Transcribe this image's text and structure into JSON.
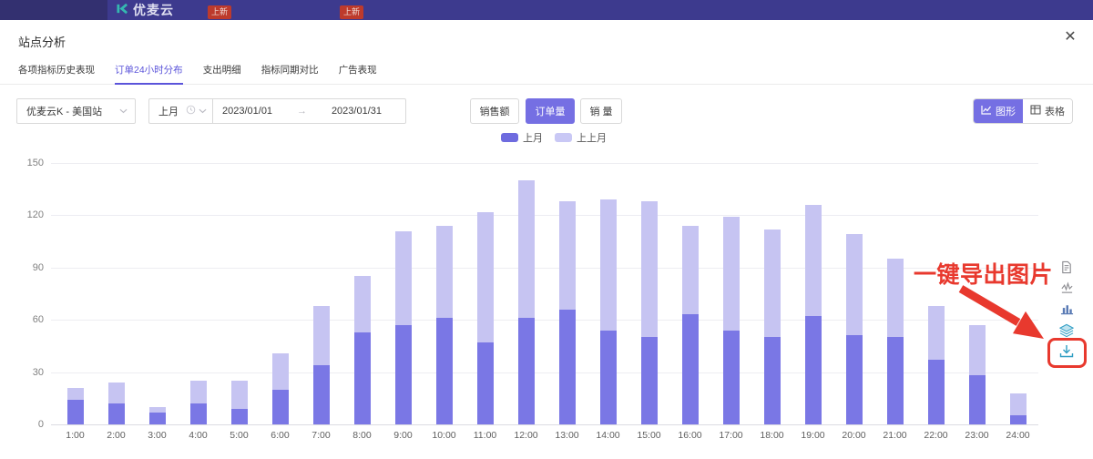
{
  "navbar": {
    "logo_text": "优麦云",
    "badges": [
      "上新",
      "上新"
    ],
    "bg_color": "#3d3a8e"
  },
  "panel": {
    "title": "站点分析",
    "close_label": "✕"
  },
  "tabs": [
    {
      "label": "各项指标历史表现",
      "active": false
    },
    {
      "label": "订单24小时分布",
      "active": true
    },
    {
      "label": "支出明细",
      "active": false
    },
    {
      "label": "指标同期对比",
      "active": false
    },
    {
      "label": "广告表现",
      "active": false
    }
  ],
  "filters": {
    "site_value": "优麦云K - 美国站",
    "period_value": "上月",
    "date_start": "2023/01/01",
    "date_arrow": "→",
    "date_end": "2023/01/31"
  },
  "metric_buttons": [
    {
      "label": "销售额",
      "active": false
    },
    {
      "label": "订单量",
      "active": true
    },
    {
      "label": "销 量",
      "active": false
    }
  ],
  "view_toggle": [
    {
      "label": "图形",
      "icon": "line-chart-icon",
      "active": true
    },
    {
      "label": "表格",
      "icon": "table-icon",
      "active": false
    }
  ],
  "legend": [
    {
      "label": "上月",
      "color": "#6e6bdf"
    },
    {
      "label": "上上月",
      "color": "#c9c8f5"
    }
  ],
  "annotation": {
    "text": "一键导出图片",
    "color": "#e8392e"
  },
  "side_icons": [
    "document-icon",
    "pulse-chart-icon",
    "bar-chart-icon",
    "layers-icon",
    "download-icon"
  ],
  "chart_data": {
    "type": "bar",
    "stacked": true,
    "title": "",
    "xlabel": "",
    "ylabel": "",
    "ylim": [
      0,
      150
    ],
    "yticks": [
      0,
      30,
      60,
      90,
      120,
      150
    ],
    "grid": true,
    "legend_position": "top-center",
    "categories": [
      "1:00",
      "2:00",
      "3:00",
      "4:00",
      "5:00",
      "6:00",
      "7:00",
      "8:00",
      "9:00",
      "10:00",
      "11:00",
      "12:00",
      "13:00",
      "14:00",
      "15:00",
      "16:00",
      "17:00",
      "18:00",
      "19:00",
      "20:00",
      "21:00",
      "22:00",
      "23:00",
      "24:00"
    ],
    "series": [
      {
        "name": "上月",
        "color": "#7a77e5",
        "values": [
          14,
          12,
          7,
          12,
          9,
          20,
          34,
          53,
          57,
          61,
          47,
          61,
          66,
          54,
          50,
          63,
          54,
          50,
          62,
          51,
          50,
          37,
          28,
          5
        ]
      },
      {
        "name": "上上月",
        "color": "#c6c4f2",
        "values": [
          7,
          12,
          3,
          13,
          16,
          21,
          34,
          32,
          54,
          53,
          75,
          79,
          62,
          75,
          78,
          51,
          65,
          62,
          64,
          58,
          45,
          31,
          29,
          13
        ]
      }
    ]
  }
}
